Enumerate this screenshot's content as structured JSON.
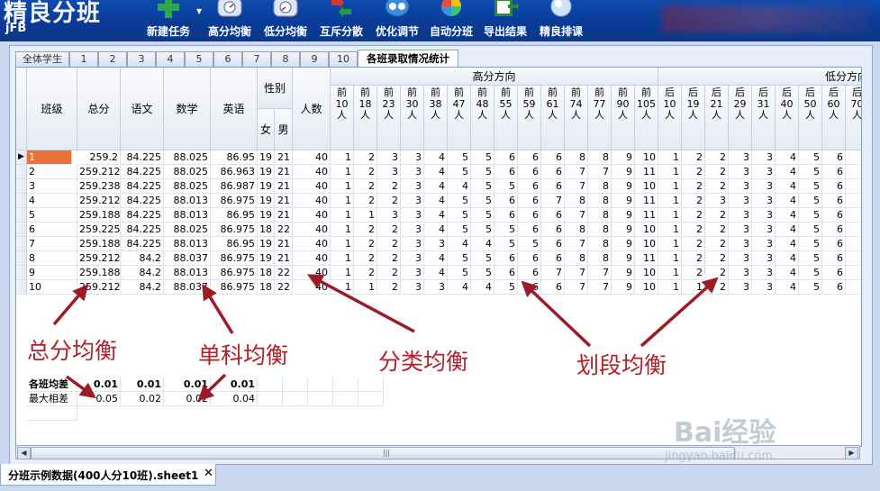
{
  "app": {
    "logo": "精良分班",
    "sub": "jFB"
  },
  "toolbar": [
    {
      "label": "新建任务",
      "icon": "new-task-icon"
    },
    {
      "label": "高分均衡",
      "icon": "high-balance-icon"
    },
    {
      "label": "低分均衡",
      "icon": "low-balance-icon"
    },
    {
      "label": "互斥分散",
      "icon": "mutex-scatter-icon"
    },
    {
      "label": "优化调节",
      "icon": "optimize-icon"
    },
    {
      "label": "自动分班",
      "icon": "auto-class-icon"
    },
    {
      "label": "导出结果",
      "icon": "export-icon"
    },
    {
      "label": "精良排课",
      "icon": "schedule-icon"
    }
  ],
  "tabs": [
    "全体学生",
    "1",
    "2",
    "3",
    "4",
    "5",
    "6",
    "7",
    "8",
    "9",
    "10",
    "各班录取情况统计"
  ],
  "active_tab": 11,
  "grid": {
    "headers": {
      "class": "班级",
      "total": "总分",
      "chinese": "语文",
      "math": "数学",
      "english": "英语",
      "gender": "性别",
      "female": "女",
      "male": "男",
      "count": "人数"
    },
    "high_group": "高分方向",
    "low_group": "低分方向",
    "high_cols": [
      "前10人",
      "前18人",
      "前23人",
      "前30人",
      "前38人",
      "前47人",
      "前48人",
      "前55人",
      "前59人",
      "前61人",
      "前74人",
      "前77人",
      "前90人",
      "前105人"
    ],
    "low_cols": [
      "后10人",
      "后19人",
      "后21人",
      "后29人",
      "后31人",
      "后40人",
      "后50人",
      "后60人",
      "后70人"
    ],
    "rows": [
      [
        "1",
        "259.2",
        "84.225",
        "88.025",
        "86.95",
        "19",
        "21",
        "40",
        "1",
        "2",
        "3",
        "3",
        "4",
        "5",
        "5",
        "6",
        "6",
        "6",
        "8",
        "8",
        "9",
        "10",
        "1",
        "2",
        "2",
        "3",
        "3",
        "4",
        "5",
        "6"
      ],
      [
        "2",
        "259.212",
        "84.225",
        "88.025",
        "86.963",
        "19",
        "21",
        "40",
        "1",
        "2",
        "3",
        "3",
        "4",
        "5",
        "5",
        "6",
        "6",
        "6",
        "7",
        "7",
        "9",
        "11",
        "1",
        "2",
        "2",
        "3",
        "3",
        "4",
        "5",
        "6"
      ],
      [
        "3",
        "259.238",
        "84.225",
        "88.025",
        "86.987",
        "19",
        "21",
        "40",
        "1",
        "2",
        "2",
        "3",
        "4",
        "4",
        "5",
        "5",
        "6",
        "6",
        "7",
        "8",
        "9",
        "10",
        "1",
        "2",
        "2",
        "3",
        "3",
        "4",
        "5",
        "6"
      ],
      [
        "4",
        "259.212",
        "84.225",
        "88.013",
        "86.975",
        "19",
        "21",
        "40",
        "1",
        "2",
        "2",
        "3",
        "4",
        "5",
        "5",
        "6",
        "6",
        "7",
        "8",
        "8",
        "9",
        "11",
        "1",
        "2",
        "3",
        "3",
        "3",
        "4",
        "5",
        "6"
      ],
      [
        "5",
        "259.188",
        "84.225",
        "88.013",
        "86.95",
        "19",
        "21",
        "40",
        "1",
        "1",
        "3",
        "3",
        "4",
        "5",
        "5",
        "6",
        "6",
        "6",
        "7",
        "8",
        "9",
        "11",
        "1",
        "2",
        "2",
        "3",
        "3",
        "4",
        "5",
        "6"
      ],
      [
        "6",
        "259.225",
        "84.225",
        "88.025",
        "86.975",
        "18",
        "22",
        "40",
        "1",
        "2",
        "2",
        "3",
        "4",
        "5",
        "5",
        "5",
        "6",
        "6",
        "8",
        "8",
        "9",
        "10",
        "1",
        "2",
        "2",
        "3",
        "3",
        "4",
        "5",
        "6"
      ],
      [
        "7",
        "259.188",
        "84.225",
        "88.013",
        "86.95",
        "19",
        "21",
        "40",
        "1",
        "2",
        "2",
        "3",
        "3",
        "4",
        "4",
        "5",
        "5",
        "6",
        "7",
        "8",
        "9",
        "10",
        "1",
        "2",
        "2",
        "3",
        "3",
        "4",
        "5",
        "6"
      ],
      [
        "8",
        "259.212",
        "84.2",
        "88.037",
        "86.975",
        "19",
        "21",
        "40",
        "1",
        "2",
        "2",
        "3",
        "4",
        "5",
        "5",
        "6",
        "6",
        "6",
        "8",
        "8",
        "9",
        "11",
        "1",
        "2",
        "2",
        "3",
        "3",
        "4",
        "5",
        "6"
      ],
      [
        "9",
        "259.188",
        "84.2",
        "88.013",
        "86.975",
        "18",
        "22",
        "40",
        "1",
        "2",
        "2",
        "3",
        "4",
        "5",
        "5",
        "6",
        "6",
        "7",
        "7",
        "7",
        "9",
        "10",
        "1",
        "2",
        "2",
        "3",
        "3",
        "4",
        "5",
        "6"
      ],
      [
        "10",
        "259.212",
        "84.2",
        "88.037",
        "86.975",
        "18",
        "22",
        "40",
        "1",
        "1",
        "2",
        "3",
        "3",
        "4",
        "4",
        "5",
        "6",
        "6",
        "7",
        "7",
        "9",
        "10",
        "1",
        "1",
        "2",
        "3",
        "3",
        "4",
        "5",
        "6"
      ]
    ],
    "summary": [
      {
        "label": "各班均差",
        "values": [
          "0.01",
          "0.01",
          "0.01",
          "0.01"
        ],
        "bold": true
      },
      {
        "label": "最大相差",
        "values": [
          "0.05",
          "0.02",
          "0.02",
          "0.04"
        ],
        "bold": false
      }
    ]
  },
  "annotations": [
    "总分均衡",
    "单科均衡",
    "分类均衡",
    "划段均衡"
  ],
  "doc_tab": {
    "label": "分班示例数据(400人分10班).sheet1",
    "close": "✕"
  },
  "watermark": {
    "text": "Bai经验",
    "url": "jingyan.baidu.com"
  },
  "colors": {
    "toolbar": "#0b3d99",
    "selection": "#e8723a",
    "annotation": "#b3202a"
  }
}
